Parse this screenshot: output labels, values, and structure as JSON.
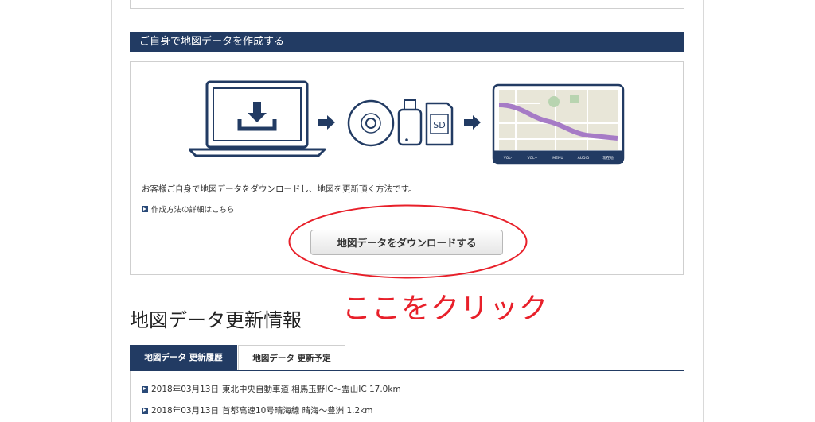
{
  "section": {
    "title": "ご自身で地図データを作成する"
  },
  "panel": {
    "description": "お客様ご自身で地図データをダウンロードし、地図を更新頂く方法です。",
    "detail_link": "作成方法の詳細はこちら",
    "download_button": "地図データをダウンロードする"
  },
  "diagram": {
    "sd_label": "SD",
    "nav_buttons": [
      "VOL-",
      "VOL+",
      "MENU",
      "AUDIO",
      "現在地"
    ]
  },
  "annotation": {
    "text": "ここをクリック",
    "color": "#e8202a"
  },
  "map_info": {
    "title": "地図データ更新情報",
    "tabs": [
      {
        "label": "地図データ 更新履歴",
        "active": true
      },
      {
        "label": "地図データ 更新予定",
        "active": false
      }
    ],
    "history": [
      {
        "date": "2018年03月13日",
        "text": "東北中央自動車道 相馬玉野IC～霊山IC 17.0km"
      },
      {
        "date": "2018年03月13日",
        "text": "首都高速10号晴海線 晴海～豊洲 1.2km"
      }
    ]
  },
  "colors": {
    "navy": "#223b63",
    "red": "#e8202a"
  }
}
